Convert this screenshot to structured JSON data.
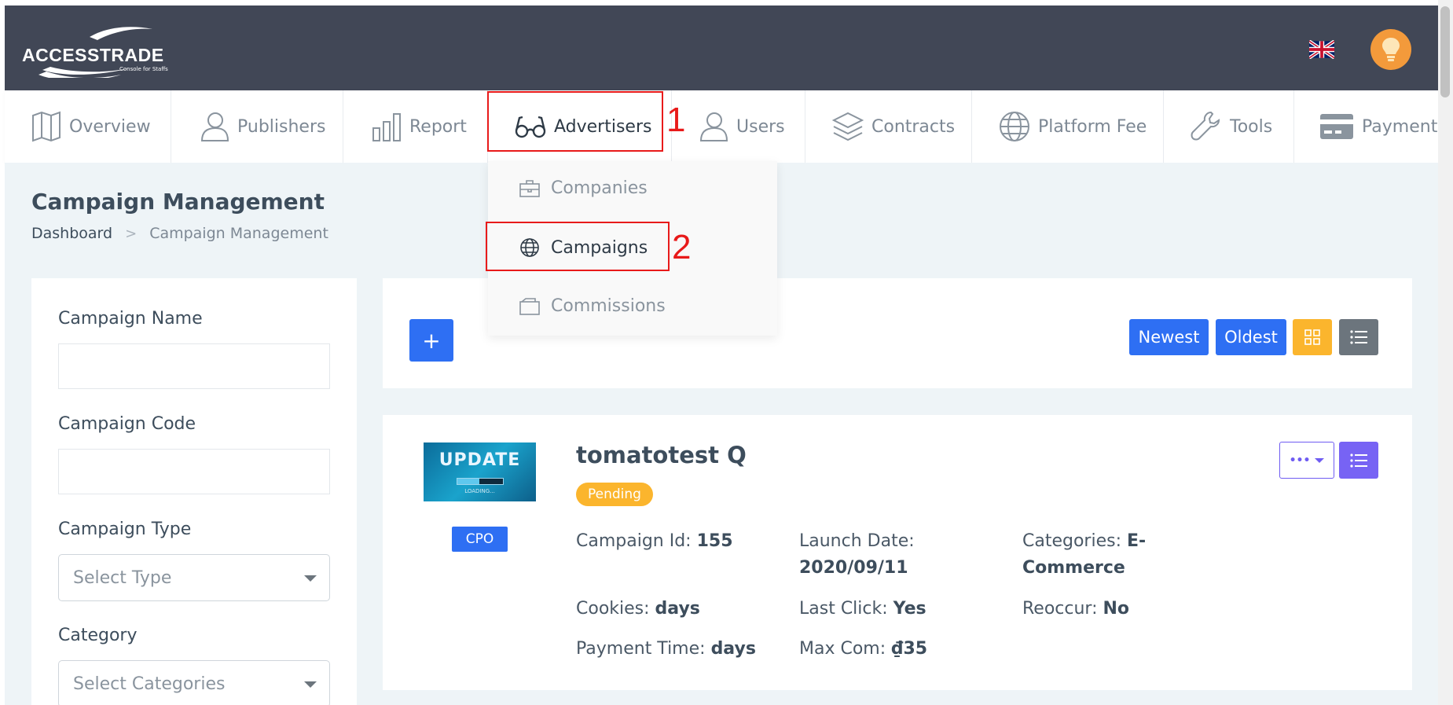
{
  "header": {
    "logo_text": "ACCESSTRADE",
    "logo_tagline": "Console for Staffs",
    "language_icon": "uk-flag-icon",
    "avatar_icon": "lightbulb-icon"
  },
  "nav": {
    "items": [
      {
        "label": "Overview",
        "icon": "map-icon"
      },
      {
        "label": "Publishers",
        "icon": "user-icon"
      },
      {
        "label": "Report",
        "icon": "bar-chart-icon"
      },
      {
        "label": "Advertisers",
        "icon": "glasses-icon"
      },
      {
        "label": "Users",
        "icon": "users-icon"
      },
      {
        "label": "Contracts",
        "icon": "layers-icon"
      },
      {
        "label": "Platform Fee",
        "icon": "globe-icon"
      },
      {
        "label": "Tools",
        "icon": "wrench-icon"
      },
      {
        "label": "Payment",
        "icon": "credit-card-icon"
      }
    ]
  },
  "dropdown": {
    "items": [
      {
        "label": "Companies",
        "icon": "briefcase-icon"
      },
      {
        "label": "Campaigns",
        "icon": "globe-icon"
      },
      {
        "label": "Commissions",
        "icon": "wallet-icon"
      }
    ]
  },
  "annotations": {
    "one": "1",
    "two": "2"
  },
  "page": {
    "title": "Campaign Management",
    "breadcrumb": {
      "home": "Dashboard",
      "current": "Campaign Management"
    }
  },
  "filters": {
    "campaign_name_label": "Campaign Name",
    "campaign_name_value": "",
    "campaign_code_label": "Campaign Code",
    "campaign_code_value": "",
    "campaign_type_label": "Campaign Type",
    "campaign_type_placeholder": "Select Type",
    "category_label": "Category",
    "category_placeholder": "Select Categories"
  },
  "toolbar": {
    "add_label": "+",
    "newest_label": "Newest",
    "oldest_label": "Oldest",
    "grid_view_icon": "grid-icon",
    "list_view_icon": "list-icon"
  },
  "campaign": {
    "thumb_text": "UPDATE",
    "thumb_subtext": "LOADING...",
    "type": "CPO",
    "name": "tomatotest Q",
    "status": "Pending",
    "id_label": "Campaign Id:",
    "id_value": "155",
    "launch_label": "Launch Date:",
    "launch_value": "2020/09/11",
    "categories_label": "Categories:",
    "categories_value_1": "E-",
    "categories_value_2": "Commerce",
    "cookies_label": "Cookies:",
    "cookies_value": "days",
    "last_click_label": "Last Click:",
    "last_click_value": "Yes",
    "reoccur_label": "Reoccur:",
    "reoccur_value": "No",
    "payment_time_label": "Payment Time:",
    "payment_time_value": "days",
    "max_com_label": "Max Com:",
    "max_com_value": "₫35",
    "more_label": "•••"
  },
  "colors": {
    "primary": "#2e6ff3",
    "topbar": "#414756",
    "warning": "#fbb52d",
    "purple": "#7763f4",
    "annotation": "#e81a1a"
  }
}
